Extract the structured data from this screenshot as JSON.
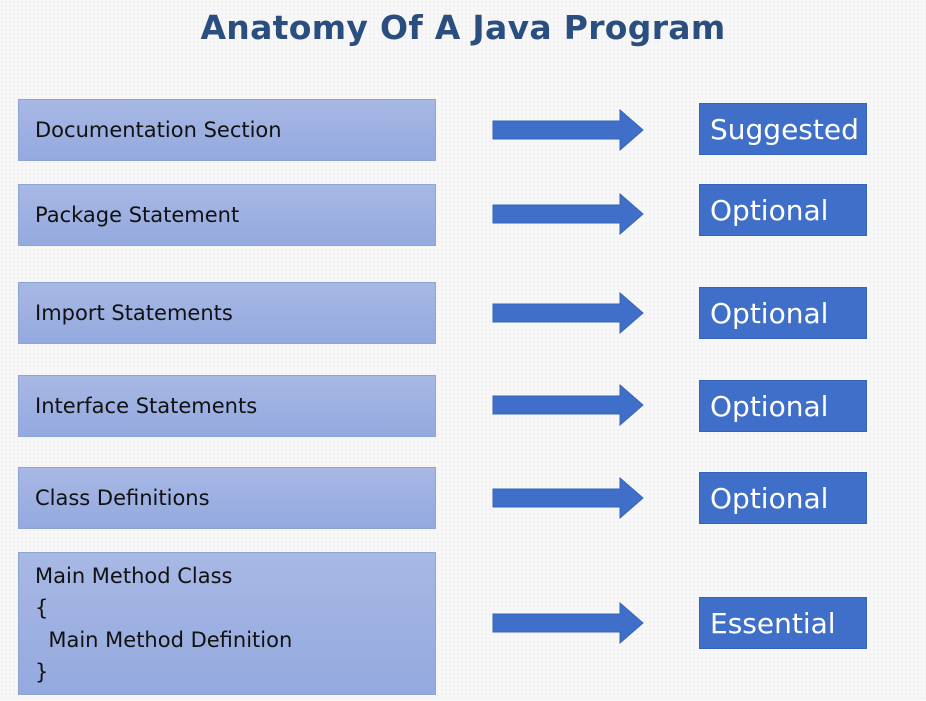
{
  "title": "Anatomy Of A Java Program",
  "rows": [
    {
      "section": "Documentation Section",
      "status": "Suggested"
    },
    {
      "section": "Package Statement",
      "status": "Optional"
    },
    {
      "section": "Import Statements",
      "status": "Optional"
    },
    {
      "section": "Interface Statements",
      "status": "Optional"
    },
    {
      "section": "Class Definitions",
      "status": "Optional"
    },
    {
      "section_lines": [
        "Main Method Class",
        "{",
        "  Main Method Definition",
        "}"
      ],
      "status": "Essential"
    }
  ],
  "colors": {
    "title": "#2b4e80",
    "section_fill": "#a3b5e3",
    "arrow": "#3f6fc8",
    "badge": "#3f6fc8"
  },
  "icons": {
    "connector": "right-arrow-icon"
  }
}
